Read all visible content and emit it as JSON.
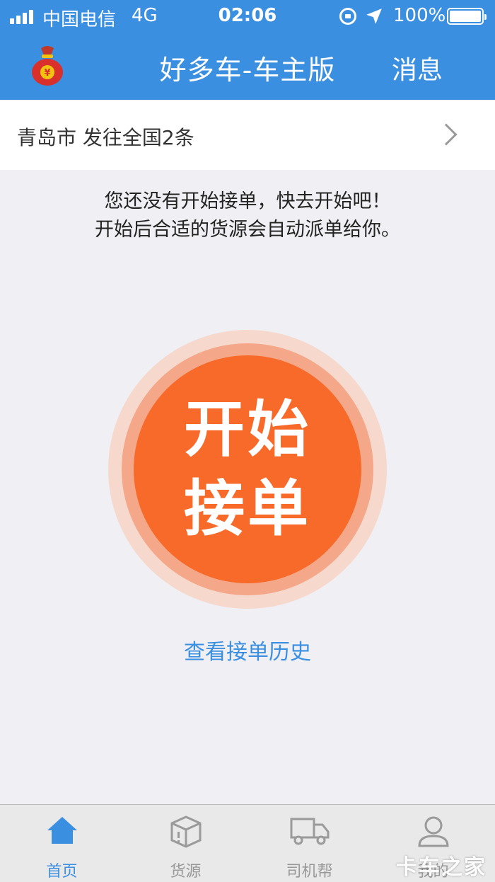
{
  "status_bar": {
    "carrier": "中国电信",
    "network": "4G",
    "time": "02:06",
    "battery": "100%"
  },
  "header": {
    "title": "好多车-车主版",
    "message_label": "消息",
    "logo_icon": "money-bag-icon"
  },
  "route": {
    "text": "青岛市 发往全国2条"
  },
  "hint": {
    "line1": "您还没有开始接单，快去开始吧！",
    "line2": "开始后合适的货源会自动派单给你。"
  },
  "start_button": {
    "line1": "开始",
    "line2": "接单"
  },
  "history_link": "查看接单历史",
  "tabs": [
    {
      "label": "首页",
      "icon": "home-icon",
      "active": true
    },
    {
      "label": "货源",
      "icon": "package-icon",
      "active": false
    },
    {
      "label": "司机帮",
      "icon": "truck-icon",
      "active": false
    },
    {
      "label": "我的",
      "icon": "user-icon",
      "active": false
    }
  ],
  "watermark": "卡车之家",
  "colors": {
    "brand_blue": "#3b8fe0",
    "accent_orange": "#f86a2a",
    "background": "#efeff4"
  }
}
